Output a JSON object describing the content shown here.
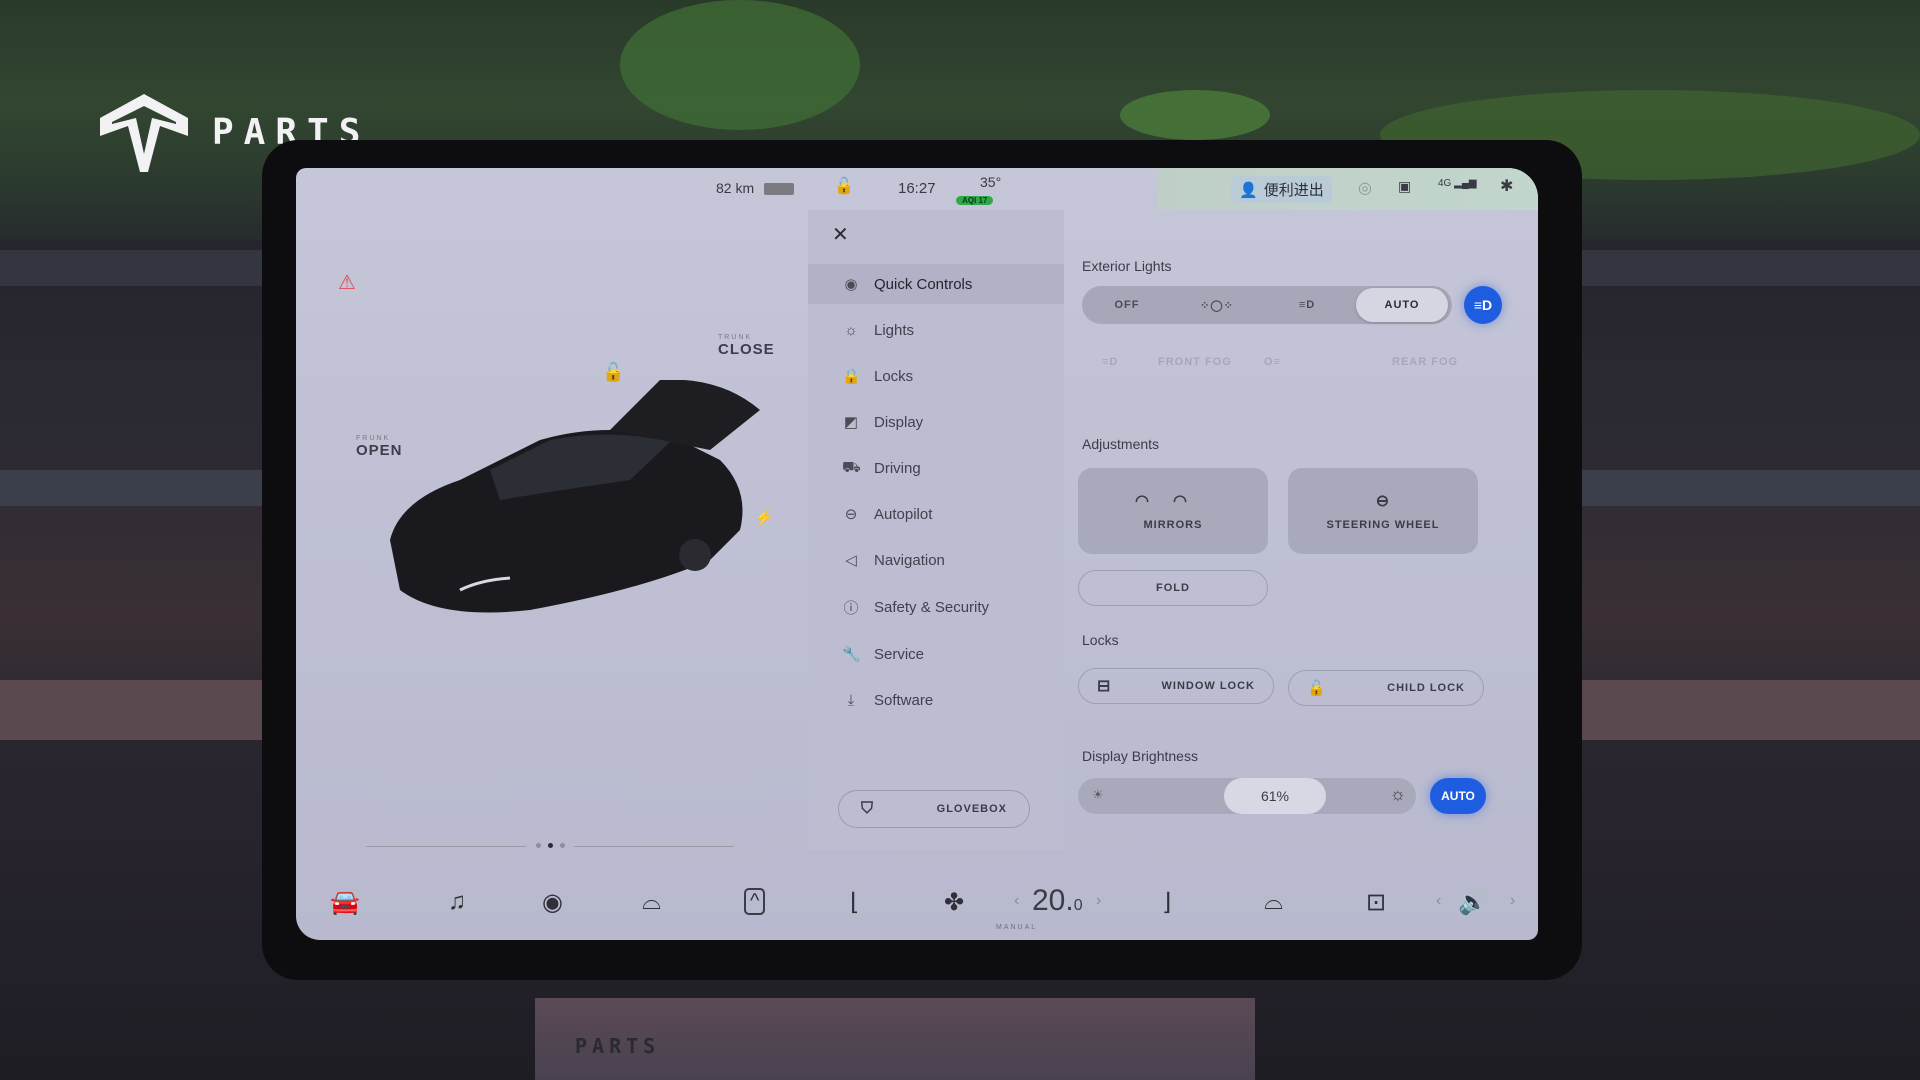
{
  "brand": {
    "logo_text": "PARTS",
    "stand_logo_text": "PARTS"
  },
  "status_bar": {
    "range": "82 km",
    "time": "16:27",
    "temperature": "35°",
    "aqi_badge": "AQI 17",
    "profile_name": "便利进出",
    "signal": "4G"
  },
  "car_view": {
    "frunk": {
      "label": "FRUNK",
      "action": "OPEN"
    },
    "trunk": {
      "label": "TRUNK",
      "action": "CLOSE"
    },
    "pager": {
      "count": 3,
      "active": 2
    }
  },
  "menu": {
    "items": [
      {
        "label": "Quick Controls",
        "icon": "toggle-icon",
        "active": true
      },
      {
        "label": "Lights",
        "icon": "light-bulb-icon"
      },
      {
        "label": "Locks",
        "icon": "lock-icon"
      },
      {
        "label": "Display",
        "icon": "display-icon"
      },
      {
        "label": "Driving",
        "icon": "car-icon"
      },
      {
        "label": "Autopilot",
        "icon": "steering-wheel-icon"
      },
      {
        "label": "Navigation",
        "icon": "navigation-arrow-icon"
      },
      {
        "label": "Safety & Security",
        "icon": "alert-circle-icon"
      },
      {
        "label": "Service",
        "icon": "wrench-icon"
      },
      {
        "label": "Software",
        "icon": "download-icon"
      }
    ],
    "glovebox_label": "GLOVEBOX"
  },
  "quick_controls": {
    "exterior_lights": {
      "title": "Exterior Lights",
      "options": [
        "OFF",
        "parking-lights-icon",
        "low-beam-icon",
        "AUTO"
      ],
      "selected": "AUTO",
      "high_beam_active": true,
      "front_fog_label": "FRONT FOG",
      "rear_fog_label": "REAR FOG"
    },
    "adjustments": {
      "title": "Adjustments",
      "mirrors_label": "MIRRORS",
      "steering_label": "STEERING WHEEL",
      "fold_label": "FOLD"
    },
    "locks": {
      "title": "Locks",
      "window_lock_label": "WINDOW LOCK",
      "child_lock_label": "CHILD LOCK"
    },
    "display_brightness": {
      "title": "Display Brightness",
      "value_label": "61%",
      "value": 61,
      "auto_label": "AUTO"
    }
  },
  "bottom_bar": {
    "temperature": "20.0",
    "temp_whole": "20.",
    "temp_decimal": "0",
    "climate_mode": "MANUAL"
  },
  "colors": {
    "accent_blue": "#1f5de0",
    "alert_red": "#e24a5c",
    "aqi_green": "#2fa84a"
  }
}
